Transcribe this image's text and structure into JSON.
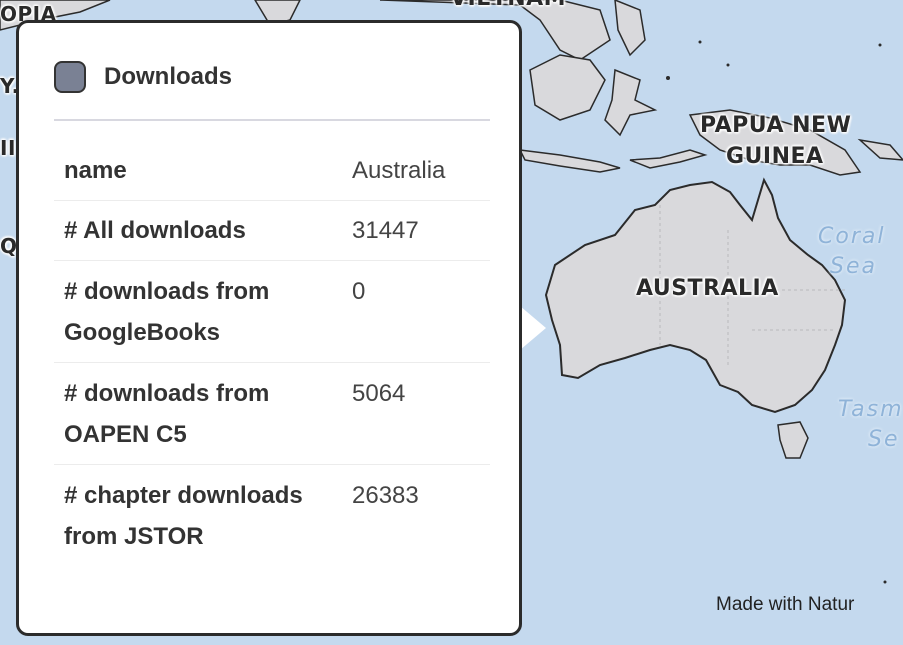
{
  "map": {
    "country_labels": [
      "VIETNAM",
      "PAPUA NEW",
      "GUINEA",
      "AUSTRALIA"
    ],
    "sea_labels": [
      "Coral",
      "Sea",
      "Tasm",
      "Se"
    ],
    "edge_labels": [
      "OPIA",
      "Y.",
      "II",
      "Q"
    ],
    "attribution": "Made with Natur",
    "colors": {
      "ocean": "#c4d9ee",
      "land": "#d9d9dc",
      "border": "#2b2b2b"
    }
  },
  "popup": {
    "title": "Downloads",
    "swatch_color": "#7a8194",
    "rows": [
      {
        "key": "name",
        "value": "Australia"
      },
      {
        "key": "# All downloads",
        "value": "31447"
      },
      {
        "key": "# downloads from GoogleBooks",
        "value": "0"
      },
      {
        "key": "# downloads from OAPEN C5",
        "value": "5064"
      },
      {
        "key": "# chapter downloads from JSTOR",
        "value": "26383"
      }
    ]
  }
}
